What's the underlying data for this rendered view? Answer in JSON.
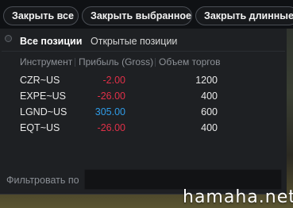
{
  "toolbar": {
    "close_all": "Закрыть все",
    "close_selected": "Закрыть выбранное",
    "close_long": "Закрыть длинные"
  },
  "tabs": [
    {
      "label": "Все позиции",
      "active": true
    },
    {
      "label": "Открытые позиции",
      "active": false
    }
  ],
  "table": {
    "columns": [
      "Инструмент",
      "Прибыль (Gross)",
      "Объем торгов"
    ],
    "rows": [
      {
        "symbol": "CZR~US",
        "profit": "-2.00",
        "volume": "1200"
      },
      {
        "symbol": "EXPE~US",
        "profit": "-26.00",
        "volume": "400"
      },
      {
        "symbol": "LGND~US",
        "profit": "305.00",
        "volume": "600"
      },
      {
        "symbol": "EQT~US",
        "profit": "-26.00",
        "volume": "400"
      }
    ]
  },
  "filter": {
    "label": "Фильтровать по",
    "value": ""
  },
  "watermark": "hamaha.net",
  "colors": {
    "negative": "#e03048",
    "positive": "#2f9be6"
  }
}
